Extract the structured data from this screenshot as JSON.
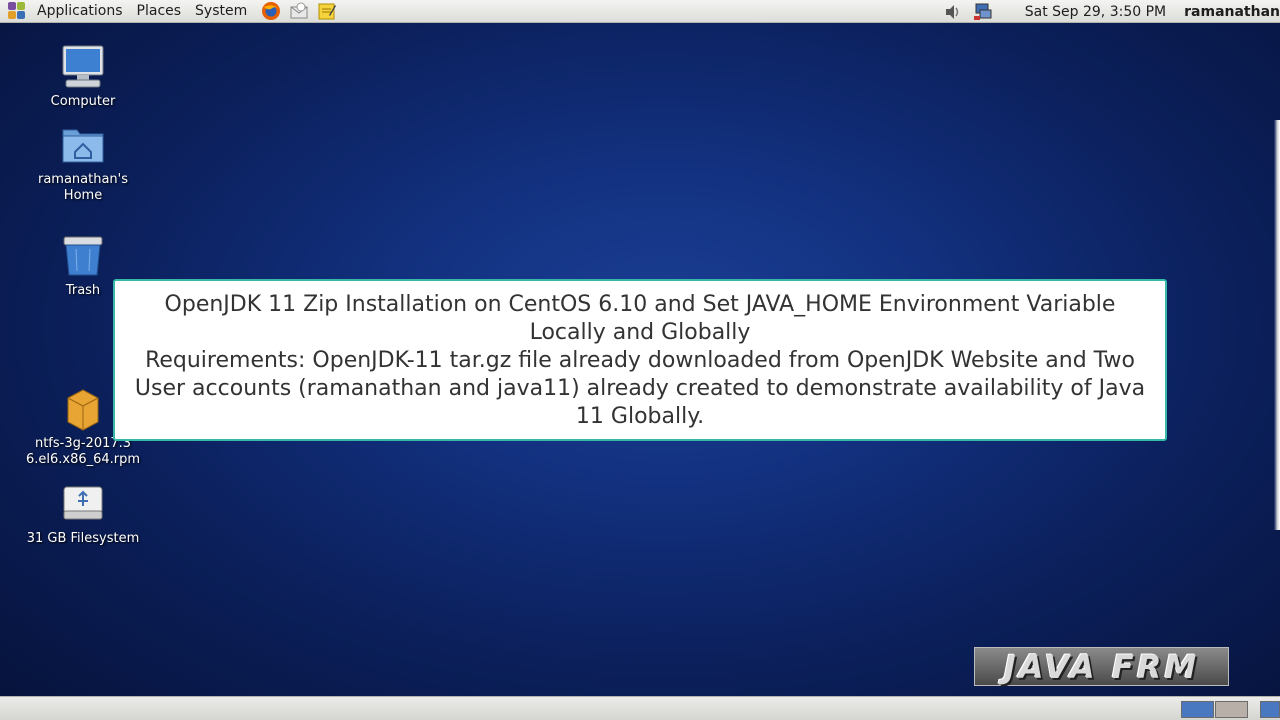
{
  "top_panel": {
    "menus": [
      "Applications",
      "Places",
      "System"
    ],
    "clock": "Sat Sep 29,  3:50 PM",
    "user": "ramanathan"
  },
  "desktop_icons": [
    {
      "label": "Computer",
      "icon": "computer-icon"
    },
    {
      "label": "ramanathan's Home",
      "icon": "home-folder-icon"
    },
    {
      "label": "Trash",
      "icon": "trash-icon"
    },
    {
      "label": "ntfs-3g-2017.3.23-6.el6.x86_64.rpm",
      "display_label": "ntfs-3g-2017.3\n6.el6.x86_64.rpm",
      "icon": "package-icon"
    },
    {
      "label": "31 GB Filesystem",
      "icon": "usb-drive-icon"
    }
  ],
  "caption": {
    "line1": "OpenJDK 11 Zip Installation on CentOS 6.10 and Set JAVA_HOME Environment Variable Locally and Globally",
    "line2": "Requirements: OpenJDK-11 tar.gz file already downloaded from OpenJDK Website and Two User accounts (ramanathan and java11) already created to demonstrate availability of Java 11 Globally."
  },
  "watermark": "JAVA FRM",
  "colors": {
    "caption_border": "#36b9a6",
    "desktop_bg": "#12307e"
  }
}
